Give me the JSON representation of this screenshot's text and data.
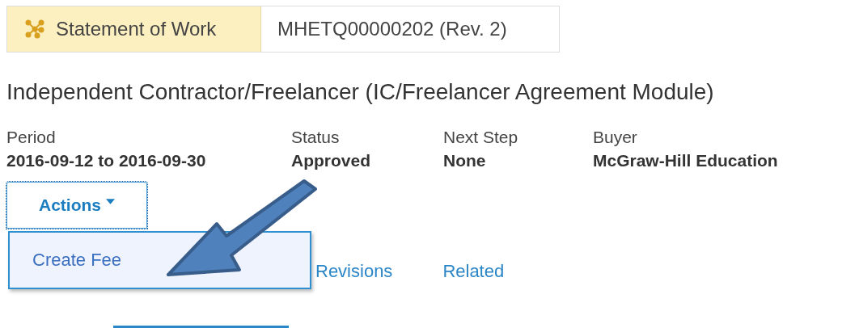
{
  "breadcrumb": {
    "type": "Statement of Work",
    "id": "MHETQ00000202 (Rev. 2)"
  },
  "title": "Independent Contractor/Freelancer (IC/Freelancer Agreement Module)",
  "fields": [
    {
      "label": "Period",
      "value": "2016-09-12 to 2016-09-30"
    },
    {
      "label": "Status",
      "value": "Approved"
    },
    {
      "label": "Next Step",
      "value": "None"
    },
    {
      "label": "Buyer",
      "value": "McGraw-Hill Education"
    }
  ],
  "actions": {
    "label": "Actions",
    "expanded": true,
    "menu": [
      "Create Fee"
    ]
  },
  "tabs": [
    "Revisions",
    "Related"
  ]
}
